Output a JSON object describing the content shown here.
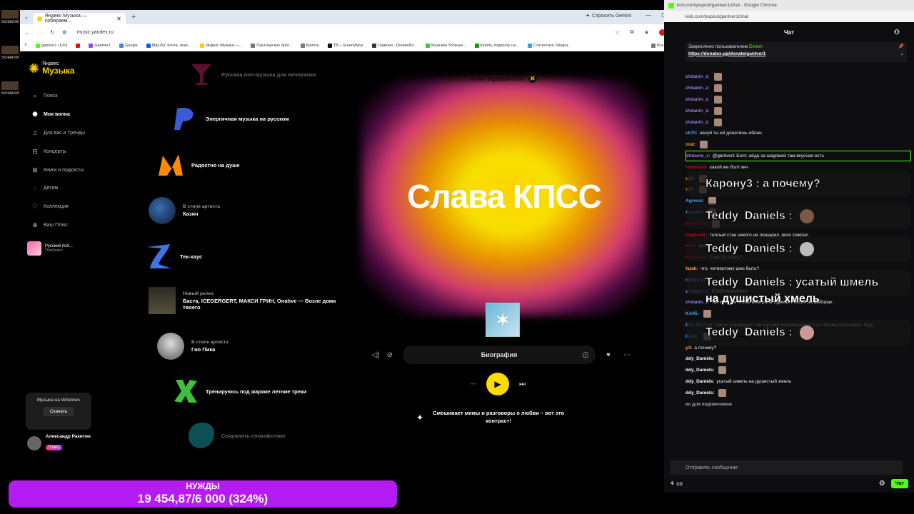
{
  "desktop": {
    "icons": [
      "Screensh",
      "Screensh",
      "Screensh"
    ]
  },
  "browser": {
    "tab_title": "Яндекс Музыка — собираем...",
    "gemini_label": "Спросить Gemini",
    "url": "music.yandex.ru",
    "bookmarks": [
      "gantver1 | Kick",
      "Gantver1",
      "Google",
      "Mail.Ru: почта, поис...",
      "Яндекс Музыка —...",
      "Партнерские прог...",
      "Крипта",
      "ТВ – GreenWave",
      "Главная - DonatePa...",
      "Мужские ботинки...",
      "Купить подписку на...",
      "Статистика Telegra..."
    ],
    "bookmarks_all": "Все закладки"
  },
  "music": {
    "logo_small": "Яндекс",
    "logo_big": "Музыка",
    "nav": [
      {
        "icon": "search-icon",
        "glyph": "⌕",
        "label": "Поиск"
      },
      {
        "icon": "wave-icon",
        "glyph": "✺",
        "label": "Моя волна"
      },
      {
        "icon": "note-icon",
        "glyph": "♫",
        "label": "Для вас и Тренды"
      },
      {
        "icon": "ticket-icon",
        "glyph": "⊟",
        "label": "Концерты"
      },
      {
        "icon": "book-icon",
        "glyph": "⊞",
        "label": "Книги и подкасты"
      },
      {
        "icon": "kids-icon",
        "glyph": "◌",
        "label": "Детям"
      },
      {
        "icon": "heart-icon",
        "glyph": "♡",
        "label": "Коллекция"
      },
      {
        "icon": "plus-icon",
        "glyph": "⊕",
        "label": "Ваш Плюс"
      }
    ],
    "playlist": {
      "title": "Русский поп...",
      "subtitle": "Плейлист"
    },
    "windows_promo": {
      "text": "Музыка на Windows",
      "button": "Скачать"
    },
    "user": {
      "name": "Александр Ракитин",
      "badge": "Плюс"
    },
    "waves": [
      {
        "sub": "",
        "name": "Русская поп-музыка для вечеринки"
      },
      {
        "sub": "",
        "name": "Энергичная музыка на русском"
      },
      {
        "sub": "",
        "name": "Радостно на душе"
      },
      {
        "sub": "В стиле артиста",
        "name": "Казян"
      },
      {
        "sub": "",
        "name": "Тек-хаус"
      },
      {
        "sub": "Новый релиз",
        "name": "Баста, ICEGERGERT, МАКСИ ГРИН, Onative — Возле дома твоего"
      },
      {
        "sub": "В стиле артиста",
        "name": "Гио Пика"
      },
      {
        "sub": "",
        "name": "Тренируюсь под жаркие летние треки"
      },
      {
        "sub": "",
        "name": "Сохранять спокойствие"
      }
    ],
    "like_tag": "Мне нравится",
    "track_title": "Слава КПСС",
    "biography": "Биография",
    "ai_text": "Смешивает мемы и разговоры о любви – вот это контраст!",
    "accent": "#ffdb00"
  },
  "chat": {
    "window_title": "kick.com/popout/gantver1/chat - Google Chrome",
    "url": "kick.com/popout/gantver1/chat",
    "header": "Чат",
    "pinned_by": "Закреплено пользователем",
    "pinned_user": "Emem",
    "pinned_link": "https://donatex.gg/donate/gantver1",
    "messages": [
      {
        "user": "zhdanin_z:",
        "text": "",
        "emote": true,
        "color": "#9f7aea"
      },
      {
        "user": "zhdanin_z:",
        "text": "",
        "emote": true,
        "color": "#9f7aea"
      },
      {
        "user": "zhdanin_z:",
        "text": "",
        "emote": true,
        "color": "#9f7aea"
      },
      {
        "user": "zhdanin_z:",
        "text": "",
        "emote": true,
        "color": "#9f7aea"
      },
      {
        "user": "zhdanin_z:",
        "text": "",
        "emote": true,
        "color": "#9f7aea"
      },
      {
        "user": "ck70:",
        "text": "нахуй ты ей донатишь еблан",
        "emote": false,
        "color": "#4aa3ff"
      },
      {
        "user": "orat:",
        "text": "",
        "emote": true,
        "color": "#f5a623"
      },
      {
        "user": "zhdanin_z:",
        "text": "@gantver1 Болт, айда за шаурмой там вкусная есть",
        "emote": false,
        "color": "#9f7aea"
      },
      {
        "user": "ntaments:",
        "text": "какой же болт ккч",
        "emote": false,
        "color": "#d0021b"
      },
      {
        "user": "s23:",
        "text": "",
        "emote": true,
        "color": "#f5a623"
      },
      {
        "user": "s23:",
        "text": "",
        "emote": true,
        "color": "#f5a623"
      },
      {
        "user": "Agressi:",
        "text": "",
        "emote": true,
        "color": "#4aa3ff"
      },
      {
        "user": "Agressi:",
        "text": "",
        "emote": true,
        "color": "#4aa3ff"
      },
      {
        "user": "ntaments:",
        "text": "",
        "emote": true,
        "color": "#d0021b"
      },
      {
        "user": "ntaments:",
        "text": "теплый стан никого не пощадил, всех сожрал",
        "emote": false,
        "color": "#d0021b"
      },
      {
        "user": "chat:",
        "text": "кра",
        "emote": false,
        "color": "#d0021b"
      },
      {
        "user": "ntaments:",
        "text": "Саш ты спать?",
        "emote": false,
        "color": "#d0021b"
      },
      {
        "user": "fatah:",
        "text": "что, четвертому дню быть?",
        "emote": false,
        "color": "#f5a623"
      },
      {
        "user": "openoran:",
        "text": "",
        "emote": false,
        "color": "#4aa3ff"
      },
      {
        "user": "zhdanin_z:",
        "text": "БЛИИИИИИИИН",
        "emote": false,
        "color": "#9f7aea"
      },
      {
        "user": "zhdanin_z:",
        "text": "так хочется чтобы выиграла Единая Россия на выборах",
        "emote": false,
        "color": "#9f7aea"
      },
      {
        "user": "KA45:",
        "text": "",
        "emote": true,
        "color": "#4aa3ff"
      },
      {
        "user": "BIG_BOYS8:",
        "text": "так он и выиграет так как уже решено давно я за яблоко голосовать буду",
        "emote": false,
        "color": "#4aa3ff"
      },
      {
        "user": "KA45:",
        "text": "",
        "emote": true,
        "color": "#4aa3ff"
      },
      {
        "user": "y3:",
        "text": "а почему?",
        "emote": false,
        "color": "#f5a623"
      },
      {
        "user": "ddy_Daniels:",
        "text": "",
        "emote": true,
        "color": "#fff"
      },
      {
        "user": "ddy_Daniels:",
        "text": "",
        "emote": true,
        "color": "#fff"
      },
      {
        "user": "ddy_Daniels:",
        "text": "усатый шмель на душистый хмель",
        "emote": false,
        "color": "#fff"
      },
      {
        "user": "ddy_Daniels:",
        "text": "",
        "emote": true,
        "color": "#fff"
      },
      {
        "user": "ко для подписчиков",
        "text": "",
        "emote": false,
        "color": "#aaa"
      }
    ],
    "input_placeholder": "Отправить сообщение",
    "send_button": "Чат",
    "accent": "#53fc18"
  },
  "overlay": {
    "bubbles": [
      {
        "text": "Карону3 : а почему?",
        "emote": false
      },
      {
        "text": "Teddy_Daniels :",
        "emote": true
      },
      {
        "text": "Teddy_Daniels :",
        "emote": true
      },
      {
        "text": "Teddy_Daniels : усатый шмель",
        "emote": false
      },
      {
        "text": "Teddy_Daniels :",
        "emote": true
      }
    ],
    "extra_line": "на душистый хмель"
  },
  "donation": {
    "label": "НУЖДЫ",
    "progress": "19 454,87/6 000 (324%)",
    "color": "#b51cf3"
  }
}
